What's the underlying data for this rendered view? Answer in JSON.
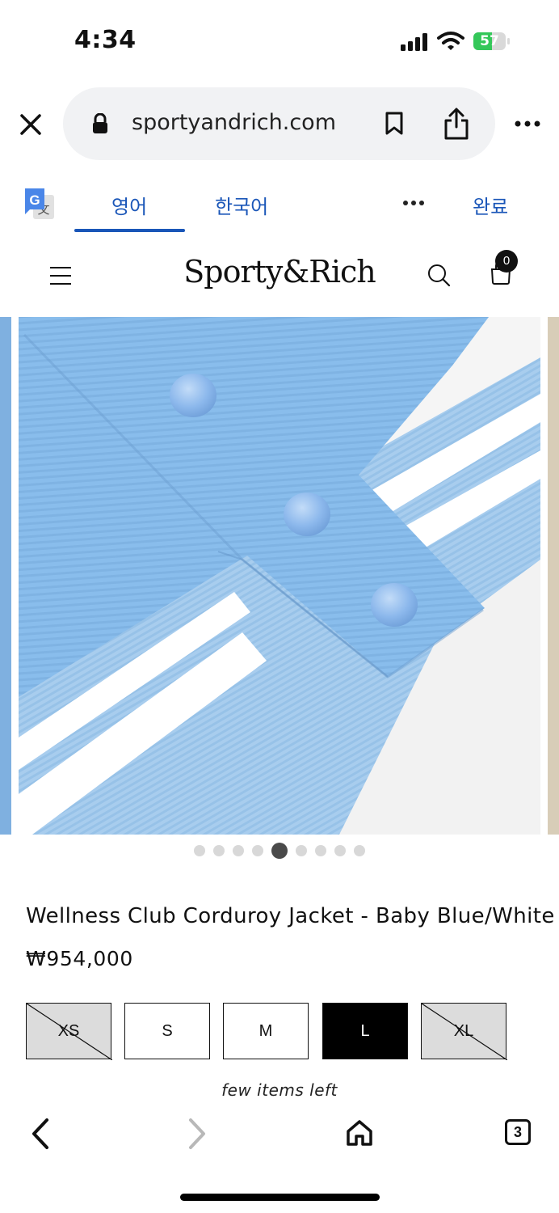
{
  "status_bar": {
    "time": "4:34",
    "battery": "57",
    "battery_level": 0.57
  },
  "browser": {
    "url": "sportyandrich.com",
    "open_tabs": "3"
  },
  "translate_bar": {
    "tab_source": "영어",
    "tab_target": "한국어",
    "done": "완료"
  },
  "site": {
    "brand": "Sporty&Rich",
    "cart_count": "0"
  },
  "gallery": {
    "image_count": 9,
    "active_index": 4
  },
  "product": {
    "title": "Wellness Club Corduroy Jacket - Baby Blue/White",
    "price": "₩954,000",
    "sizes": [
      {
        "label": "XS",
        "state": "unavailable"
      },
      {
        "label": "S",
        "state": "available"
      },
      {
        "label": "M",
        "state": "available"
      },
      {
        "label": "L",
        "state": "selected"
      },
      {
        "label": "XL",
        "state": "unavailable"
      }
    ],
    "stock_note": "few items left"
  },
  "colors": {
    "link_blue": "#1a56b8",
    "battery_green": "#34c759",
    "fabric_blue": "#86b9e8"
  }
}
